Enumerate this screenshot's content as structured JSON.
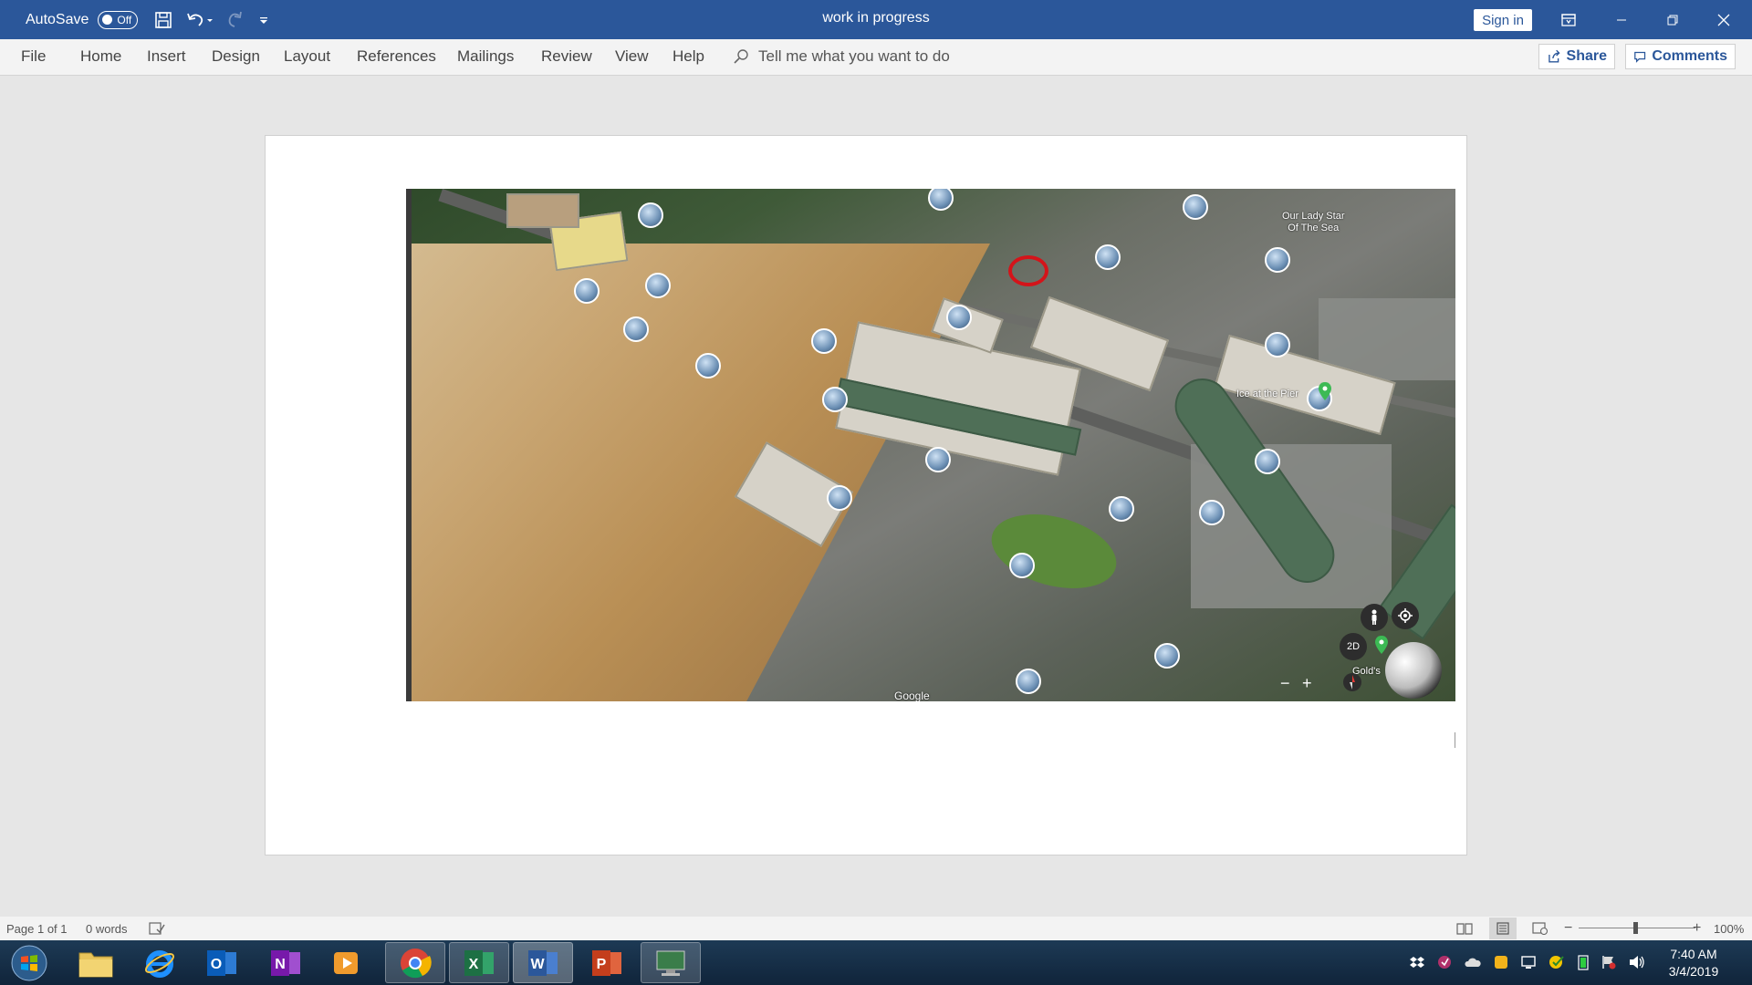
{
  "titlebar": {
    "autosave_label": "AutoSave",
    "autosave_state": "Off",
    "document_title": "work in progress",
    "signin_label": "Sign in"
  },
  "ribbon": {
    "tabs": [
      "File",
      "Home",
      "Insert",
      "Design",
      "Layout",
      "References",
      "Mailings",
      "Review",
      "View",
      "Help"
    ],
    "tell_me": "Tell me what you want to do",
    "share_label": "Share",
    "comments_label": "Comments"
  },
  "map": {
    "label_church": "Our Lady Star\nOf The Sea",
    "label_pier": "Ice at the Pier",
    "label_google": "Google",
    "view_toggle": "2D",
    "label_gold": "Gold's"
  },
  "statusbar": {
    "page_info": "Page 1 of 1",
    "word_count": "0 words",
    "zoom": "100%"
  },
  "taskbar": {
    "time": "7:40 AM",
    "date": "3/4/2019"
  }
}
